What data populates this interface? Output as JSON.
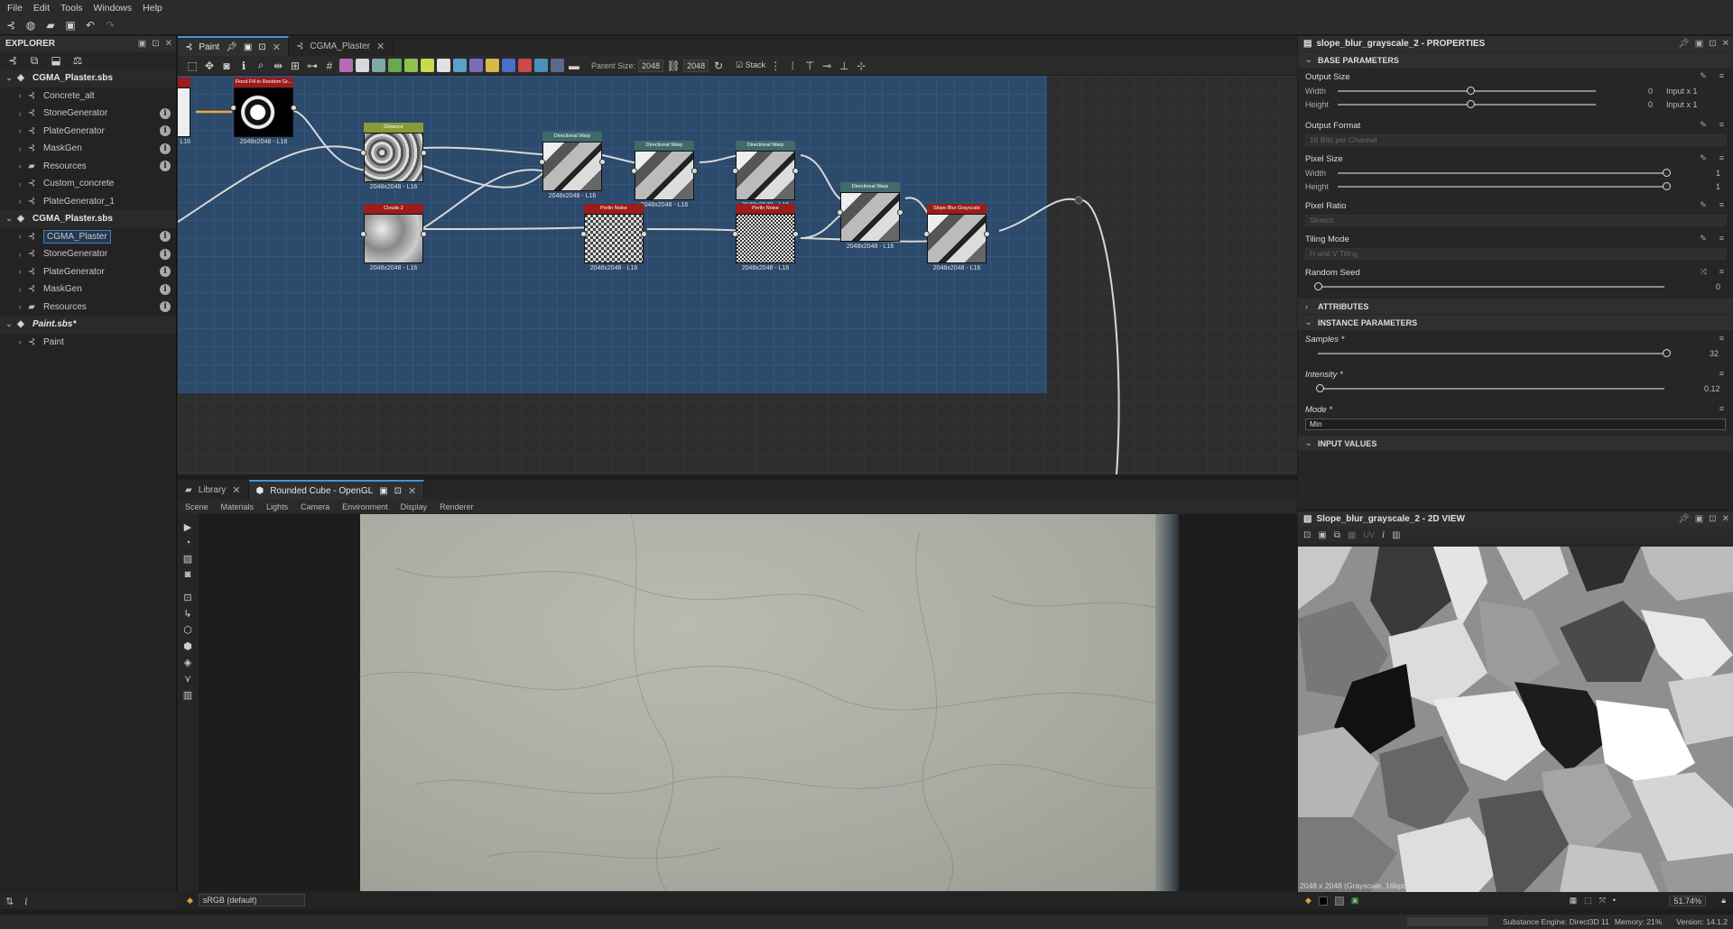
{
  "menu": [
    "File",
    "Edit",
    "Tools",
    "Windows",
    "Help"
  ],
  "explorer": {
    "title": "EXPLORER",
    "tree": [
      {
        "label": "CGMA_Plaster.sbs",
        "type": "package",
        "level": 0
      },
      {
        "label": "Concrete_alt",
        "type": "graph",
        "level": 1,
        "info": false
      },
      {
        "label": "StoneGenerator",
        "type": "graph",
        "level": 1,
        "info": true
      },
      {
        "label": "PlateGenerator",
        "type": "graph",
        "level": 1,
        "info": true
      },
      {
        "label": "MaskGen",
        "type": "graph",
        "level": 1,
        "info": true
      },
      {
        "label": "Resources",
        "type": "folder",
        "level": 1,
        "info": true
      },
      {
        "label": "Custom_concrete",
        "type": "graph",
        "level": 1,
        "info": false
      },
      {
        "label": "PlateGenerator_1",
        "type": "graph",
        "level": 1,
        "info": false
      },
      {
        "label": "CGMA_Plaster.sbs",
        "type": "package",
        "level": 0
      },
      {
        "label": "CGMA_Plaster",
        "type": "graph",
        "level": 1,
        "info": true,
        "selected": true
      },
      {
        "label": "StoneGenerator",
        "type": "graph",
        "level": 1,
        "info": true
      },
      {
        "label": "PlateGenerator",
        "type": "graph",
        "level": 1,
        "info": true
      },
      {
        "label": "MaskGen",
        "type": "graph",
        "level": 1,
        "info": true
      },
      {
        "label": "Resources",
        "type": "folder",
        "level": 1,
        "info": true
      },
      {
        "label": "Paint.sbs*",
        "type": "package",
        "level": 0,
        "italic": true
      },
      {
        "label": "Paint",
        "type": "graph",
        "level": 1,
        "info": false
      }
    ]
  },
  "graph": {
    "tabs": [
      {
        "label": "Paint",
        "active": true
      },
      {
        "label": "CGMA_Plaster",
        "active": false
      }
    ],
    "toolbar": {
      "parent_size_label": "Parent Size:",
      "parent_size_value": "2048",
      "size_value": "2048",
      "stack_label": "Stack"
    },
    "nodes": [
      {
        "id": "flood",
        "title": "Flood Fill to Random Gr...",
        "footer": "2048x2048 - L16",
        "color": "red",
        "tex": "tex-flood"
      },
      {
        "id": "distance",
        "title": "Distance",
        "footer": "2048x2048 - L16",
        "color": "green",
        "tex": "tex-noise"
      },
      {
        "id": "warp1",
        "title": "Directional Warp",
        "footer": "2048x2048 - L16",
        "color": "teal",
        "tex": "tex-warp"
      },
      {
        "id": "warp2",
        "title": "Directional Warp",
        "footer": "2048x2048 - L16",
        "color": "teal",
        "tex": "tex-warp"
      },
      {
        "id": "warp3",
        "title": "Directional Warp",
        "footer": "2048x2048 - L16",
        "color": "teal",
        "tex": "tex-warp"
      },
      {
        "id": "warp4",
        "title": "Directional Warp",
        "footer": "2048x2048 - L16",
        "color": "teal",
        "tex": "tex-warp"
      },
      {
        "id": "clouds",
        "title": "Clouds 2",
        "footer": "2048x2048 - L16",
        "color": "red",
        "tex": "tex-cloud"
      },
      {
        "id": "perlin1",
        "title": "Perlin Noise",
        "footer": "2048x2048 - L16",
        "color": "red",
        "tex": "tex-perlin"
      },
      {
        "id": "perlin2",
        "title": "Perlin Noise",
        "footer": "2048x2048 - L16",
        "color": "red",
        "tex": "tex-perlin2"
      },
      {
        "id": "slope",
        "title": "Slope Blur Grayscale",
        "footer": "2048x2048 - L16",
        "color": "red",
        "tex": "tex-warp"
      }
    ],
    "partial_node_footer": "L16"
  },
  "properties": {
    "title": "slope_blur_grayscale_2 - PROPERTIES",
    "base_section": "BASE PARAMETERS",
    "output_size": {
      "label": "Output Size",
      "width_label": "Width",
      "height_label": "Height",
      "width_value": "0",
      "height_value": "0",
      "width_rel": "Input x 1",
      "height_rel": "Input x 1"
    },
    "output_format": {
      "label": "Output Format",
      "value": "16 Bits per Channel"
    },
    "pixel_size": {
      "label": "Pixel Size",
      "width_label": "Width",
      "height_label": "Height",
      "width_value": "1",
      "height_value": "1"
    },
    "pixel_ratio": {
      "label": "Pixel Ratio",
      "value": "Stretch"
    },
    "tiling_mode": {
      "label": "Tiling Mode",
      "value": "H and V Tiling"
    },
    "random_seed": {
      "label": "Random Seed",
      "value": "0"
    },
    "attributes_section": "ATTRIBUTES",
    "instance_section": "INSTANCE PARAMETERS",
    "samples": {
      "label": "Samples *",
      "value": "32"
    },
    "intensity": {
      "label": "Intensity *",
      "value": "0.12"
    },
    "mode": {
      "label": "Mode *",
      "value": "Min"
    },
    "input_values_section": "INPUT VALUES"
  },
  "view3d": {
    "tabs": [
      {
        "label": "Library",
        "active": false
      },
      {
        "label": "Rounded Cube - OpenGL",
        "active": true
      }
    ],
    "menu": [
      "Scene",
      "Materials",
      "Lights",
      "Camera",
      "Environment",
      "Display",
      "Renderer"
    ],
    "colorspace": "sRGB (default)"
  },
  "view2d": {
    "title": "Slope_blur_grayscale_2 - 2D VIEW",
    "uv_label": "UV",
    "caption": "2048 x 2048 (Grayscale, 16bpc)",
    "zoom": "51.74%"
  },
  "status": {
    "engine": "Substance Engine: Direct3D 11",
    "memory": "Memory: 21%",
    "version": "Version: 14.1.2"
  }
}
